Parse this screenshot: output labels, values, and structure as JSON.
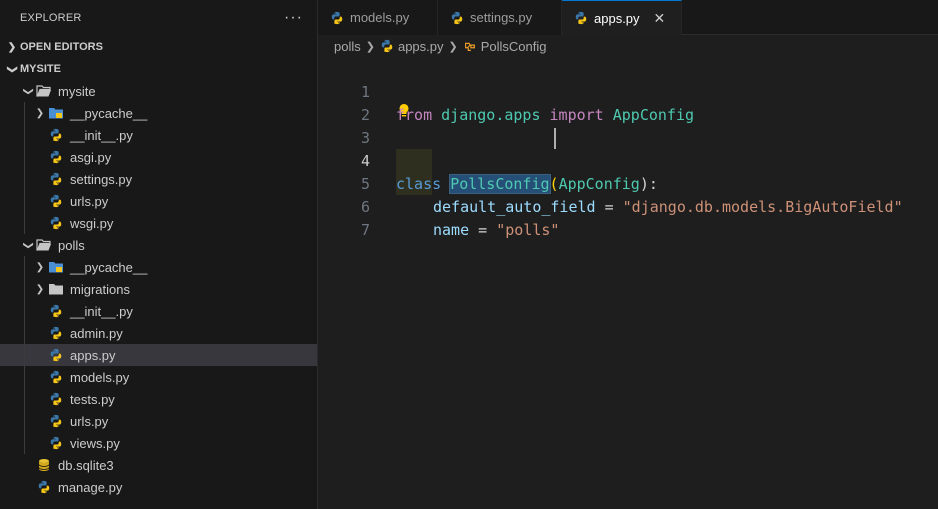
{
  "sidebar": {
    "title": "EXPLORER",
    "more": "···",
    "open_editors": "OPEN EDITORS",
    "workspace": "MYSITE",
    "tree": [
      {
        "label": "mysite",
        "kind": "folder",
        "depth": 1,
        "expanded": true
      },
      {
        "label": "__pycache__",
        "kind": "pycache",
        "depth": 2,
        "expanded": false
      },
      {
        "label": "__init__.py",
        "kind": "py",
        "depth": 2
      },
      {
        "label": "asgi.py",
        "kind": "py",
        "depth": 2
      },
      {
        "label": "settings.py",
        "kind": "py",
        "depth": 2
      },
      {
        "label": "urls.py",
        "kind": "py",
        "depth": 2
      },
      {
        "label": "wsgi.py",
        "kind": "py",
        "depth": 2
      },
      {
        "label": "polls",
        "kind": "folder",
        "depth": 1,
        "expanded": true
      },
      {
        "label": "__pycache__",
        "kind": "pycache",
        "depth": 2,
        "expanded": false
      },
      {
        "label": "migrations",
        "kind": "folder",
        "depth": 2,
        "expanded": false
      },
      {
        "label": "__init__.py",
        "kind": "py",
        "depth": 2
      },
      {
        "label": "admin.py",
        "kind": "py",
        "depth": 2
      },
      {
        "label": "apps.py",
        "kind": "py",
        "depth": 2,
        "selected": true
      },
      {
        "label": "models.py",
        "kind": "py",
        "depth": 2
      },
      {
        "label": "tests.py",
        "kind": "py",
        "depth": 2
      },
      {
        "label": "urls.py",
        "kind": "py",
        "depth": 2
      },
      {
        "label": "views.py",
        "kind": "py",
        "depth": 2
      },
      {
        "label": "db.sqlite3",
        "kind": "db",
        "depth": 1
      },
      {
        "label": "manage.py",
        "kind": "py",
        "depth": 1
      }
    ]
  },
  "tabs": [
    {
      "label": "models.py",
      "active": false
    },
    {
      "label": "settings.py",
      "active": false
    },
    {
      "label": "apps.py",
      "active": true,
      "close": "✕"
    }
  ],
  "breadcrumb": {
    "folder": "polls",
    "file": "apps.py",
    "symbol": "PollsConfig"
  },
  "editor": {
    "line_numbers": [
      "1",
      "2",
      "3",
      "4",
      "5",
      "6",
      "7"
    ],
    "current_line": "4",
    "line1": {
      "kw_from": "from",
      "module": "django.apps",
      "kw_import": "import",
      "name": "AppConfig"
    },
    "line4": {
      "kw_class": "class",
      "name": "PollsConfig",
      "paren_open": "(",
      "base": "AppConfig",
      "paren_close": "):"
    },
    "line5": {
      "var": "default_auto_field",
      "op": " = ",
      "value": "\"django.db.models.BigAutoField\""
    },
    "line6": {
      "var": "name",
      "op": " = ",
      "value": "\"polls\""
    }
  },
  "colors": {
    "python_blue": "#3b77a8",
    "python_yellow": "#f5c518",
    "folder": "#c5c5c5",
    "pycache_folder": "#4a8fd4",
    "db_yellow": "#e8c232",
    "accent": "#0078d4"
  }
}
